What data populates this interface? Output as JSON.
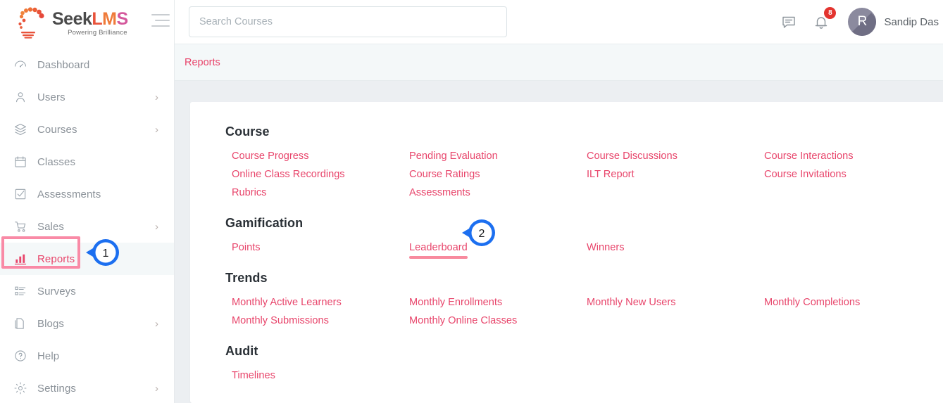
{
  "brand": {
    "name_seek": "Seek",
    "name_l": "L",
    "name_m": "M",
    "name_s": "S",
    "tagline": "Powering Brilliance",
    "accent": "#e8456b",
    "logo_orange": "#ef7b3a",
    "logo_red": "#e8533b",
    "logo_pink": "#d4589c"
  },
  "sidebar": {
    "items": [
      {
        "label": "Dashboard",
        "icon": "gauge-icon",
        "chevron": "",
        "active": false
      },
      {
        "label": "Users",
        "icon": "user-icon",
        "chevron": "›",
        "active": false
      },
      {
        "label": "Courses",
        "icon": "layers-icon",
        "chevron": "›",
        "active": false
      },
      {
        "label": "Classes",
        "icon": "calendar-icon",
        "chevron": "",
        "active": false
      },
      {
        "label": "Assessments",
        "icon": "checkbox-icon",
        "chevron": "",
        "active": false
      },
      {
        "label": "Sales",
        "icon": "cart-icon",
        "chevron": "›",
        "active": false
      },
      {
        "label": "Reports",
        "icon": "bar-chart-icon",
        "chevron": "",
        "active": true
      },
      {
        "label": "Surveys",
        "icon": "list-icon",
        "chevron": "",
        "active": false
      },
      {
        "label": "Blogs",
        "icon": "document-icon",
        "chevron": "›",
        "active": false
      },
      {
        "label": "Help",
        "icon": "question-circle-icon",
        "chevron": "",
        "active": false
      },
      {
        "label": "Settings",
        "icon": "gear-icon",
        "chevron": "›",
        "active": false
      }
    ],
    "menu_toggle_icon": "hamburger-icon"
  },
  "topbar": {
    "search_placeholder": "Search Courses",
    "search_value": "",
    "chat_icon": "chat-icon",
    "notification_icon": "bell-icon",
    "notification_count": "8",
    "avatar_initial": "R",
    "user_name": "Sandip Das",
    "user_chevron": "⌄"
  },
  "breadcrumb": {
    "label": "Reports"
  },
  "report_sections": [
    {
      "title": "Course",
      "columns": [
        [
          "Course Progress",
          "Online Class Recordings",
          "Rubrics"
        ],
        [
          "Pending Evaluation",
          "Course Ratings",
          "Assessments"
        ],
        [
          "Course Discussions",
          "ILT Report"
        ],
        [
          "Course Interactions",
          "Course Invitations"
        ]
      ]
    },
    {
      "title": "Gamification",
      "columns": [
        [
          "Points"
        ],
        [
          "Leaderboard"
        ],
        [
          "Winners"
        ],
        []
      ]
    },
    {
      "title": "Trends",
      "columns": [
        [
          "Monthly Active Learners",
          "Monthly Submissions"
        ],
        [
          "Monthly Enrollments",
          "Monthly Online Classes"
        ],
        [
          "Monthly New Users"
        ],
        [
          "Monthly Completions"
        ]
      ]
    },
    {
      "title": "Audit",
      "columns": [
        [
          "Timelines"
        ],
        [],
        [],
        []
      ]
    }
  ],
  "highlighted_link": "Leaderboard",
  "annotations": {
    "callout_color": "#1c6ff0",
    "box_color": "#f98aa6",
    "markers": [
      {
        "number": "1",
        "target": "Reports"
      },
      {
        "number": "2",
        "target": "Leaderboard"
      }
    ]
  }
}
